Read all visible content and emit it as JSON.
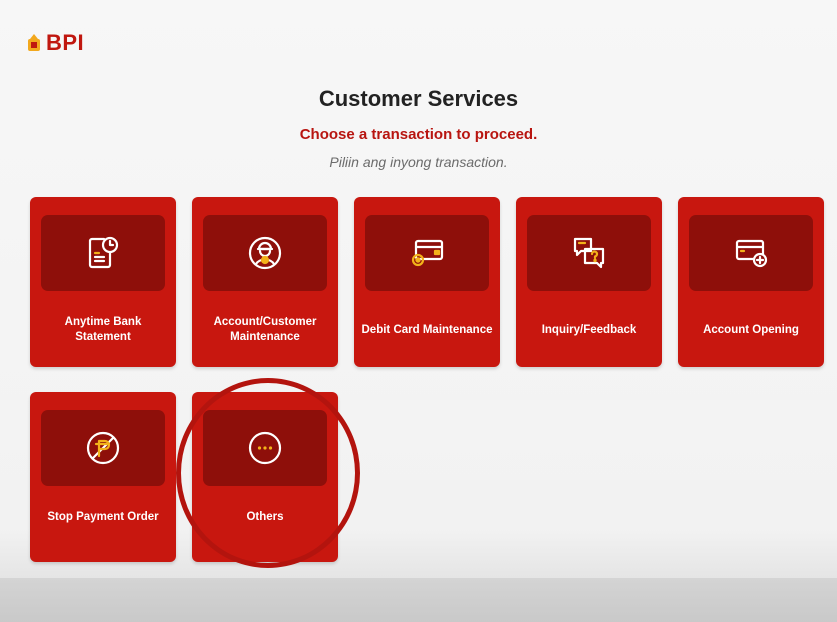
{
  "brand": {
    "name": "BPI",
    "color": "#c0170f"
  },
  "header": {
    "title": "Customer Services",
    "subtitle": "Choose a transaction to proceed.",
    "subtitle_local": "Piliin ang inyong transaction."
  },
  "tiles": [
    {
      "label": "Anytime Bank Statement",
      "icon": "statement-clock-icon"
    },
    {
      "label": "Account/Customer Maintenance",
      "icon": "customer-icon"
    },
    {
      "label": "Debit Card Maintenance",
      "icon": "debit-card-gear-icon"
    },
    {
      "label": "Inquiry/Feedback",
      "icon": "chat-question-icon"
    },
    {
      "label": "Account Opening",
      "icon": "card-plus-icon"
    },
    {
      "label": "Stop Payment Order",
      "icon": "stop-payment-icon"
    },
    {
      "label": "Others",
      "icon": "more-icon"
    }
  ],
  "colors": {
    "tile": "#c8170f",
    "tile_icon_box": "#8e0f0a",
    "icon_accent": "#f3b21a"
  }
}
